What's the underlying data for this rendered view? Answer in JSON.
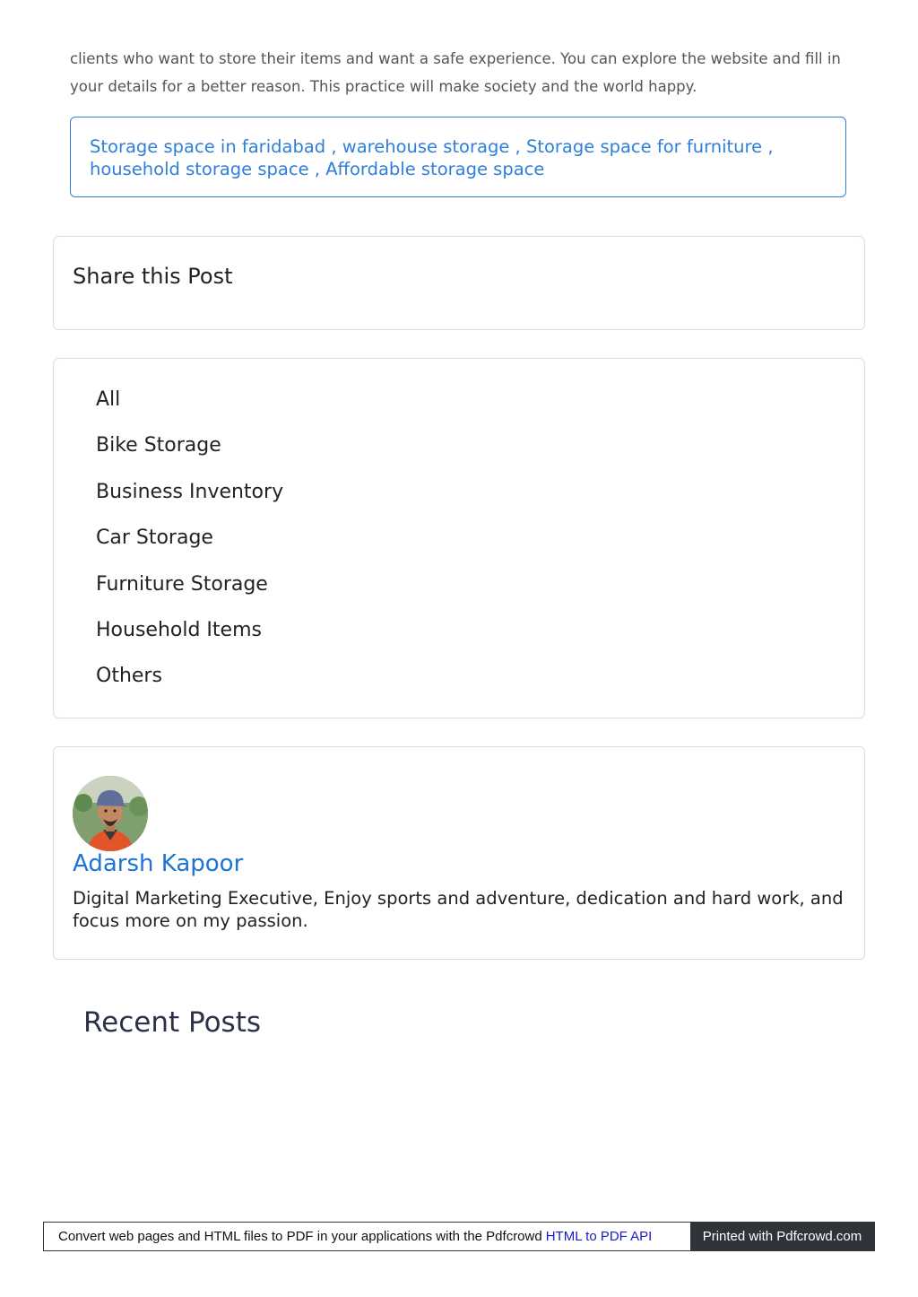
{
  "intro": {
    "text": "clients who want to store their items and want a safe experience. You can explore the website and fill in your details for a better reason. This practice will make society and the world happy."
  },
  "tags": {
    "items": [
      "Storage space in faridabad",
      "warehouse storage",
      "Storage space for furniture",
      "household storage space",
      "Affordable storage space"
    ],
    "separator": " , "
  },
  "share": {
    "title": "Share this Post"
  },
  "categories": {
    "items": [
      "All",
      "Bike Storage",
      "Business Inventory",
      "Car Storage",
      "Furniture Storage",
      "Household Items",
      "Others"
    ]
  },
  "author": {
    "name": "Adarsh Kapoor",
    "bio": "Digital Marketing Executive, Enjoy sports and adventure, dedication and hard work, and focus more on my passion.",
    "avatar_icon": "person-avatar-photo"
  },
  "recent": {
    "title": "Recent Posts"
  },
  "footer": {
    "text": "Convert web pages and HTML files to PDF in your applications with the Pdfcrowd",
    "link_label": "HTML to PDF API",
    "printed_label": "Printed with Pdfcrowd.com"
  },
  "colors": {
    "link_blue": "#2f7fd9",
    "author_blue": "#1d73d6",
    "footer_dark": "#2f343a"
  }
}
